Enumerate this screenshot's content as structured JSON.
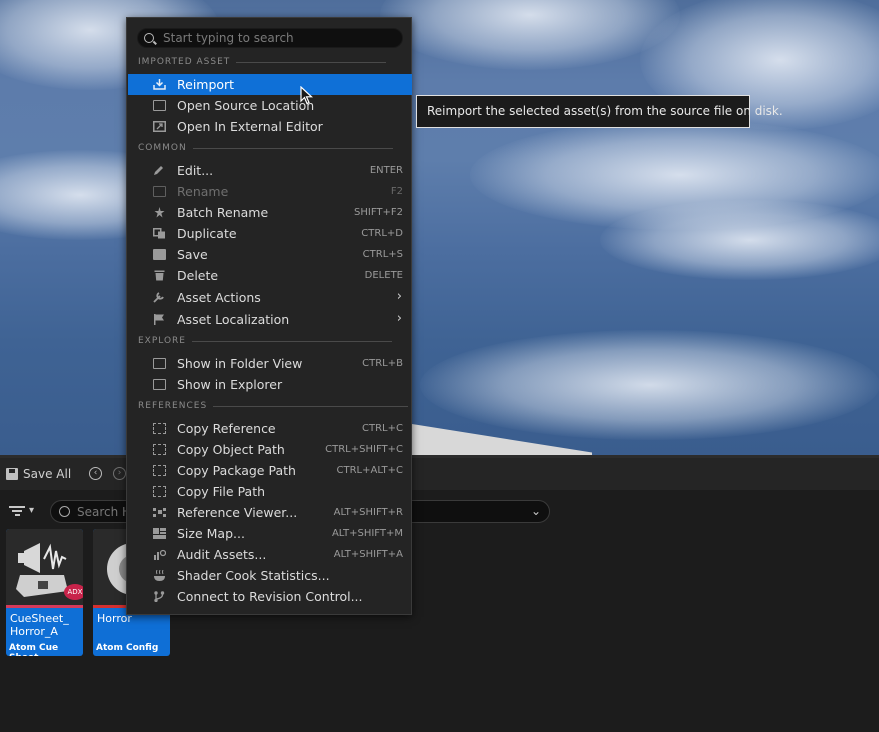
{
  "menu": {
    "search_placeholder": "Start typing to search",
    "sections": {
      "imported": "IMPORTED ASSET",
      "common": "COMMON",
      "explore": "EXPLORE",
      "references": "REFERENCES"
    },
    "imported_items": [
      {
        "label": "Reimport",
        "shortcut": "",
        "icon": "reimport-icon"
      },
      {
        "label": "Open Source Location",
        "shortcut": "",
        "icon": "open-source-location-icon"
      },
      {
        "label": "Open In External Editor",
        "shortcut": "",
        "icon": "external-editor-icon"
      }
    ],
    "common_items": [
      {
        "label": "Edit...",
        "shortcut": "ENTER",
        "icon": "pencil-icon"
      },
      {
        "label": "Rename",
        "shortcut": "F2",
        "icon": "rename-icon"
      },
      {
        "label": "Batch Rename",
        "shortcut": "SHIFT+F2",
        "icon": "batch-rename-icon"
      },
      {
        "label": "Duplicate",
        "shortcut": "CTRL+D",
        "icon": "duplicate-icon"
      },
      {
        "label": "Save",
        "shortcut": "CTRL+S",
        "icon": "save-icon"
      },
      {
        "label": "Delete",
        "shortcut": "DELETE",
        "icon": "trash-icon"
      },
      {
        "label": "Asset Actions",
        "shortcut": "",
        "icon": "wrench-icon"
      },
      {
        "label": "Asset Localization",
        "shortcut": "",
        "icon": "flag-icon"
      }
    ],
    "explore_items": [
      {
        "label": "Show in Folder View",
        "shortcut": "CTRL+B",
        "icon": "folder-search-icon"
      },
      {
        "label": "Show in Explorer",
        "shortcut": "",
        "icon": "explorer-icon"
      }
    ],
    "reference_items": [
      {
        "label": "Copy Reference",
        "shortcut": "CTRL+C",
        "icon": "copy-icon"
      },
      {
        "label": "Copy Object Path",
        "shortcut": "CTRL+SHIFT+C",
        "icon": "copy-icon"
      },
      {
        "label": "Copy Package Path",
        "shortcut": "CTRL+ALT+C",
        "icon": "copy-icon"
      },
      {
        "label": "Copy File Path",
        "shortcut": "",
        "icon": "copy-icon"
      },
      {
        "label": "Reference Viewer...",
        "shortcut": "ALT+SHIFT+R",
        "icon": "reference-viewer-icon"
      },
      {
        "label": "Size Map...",
        "shortcut": "ALT+SHIFT+M",
        "icon": "size-map-icon"
      },
      {
        "label": "Audit Assets...",
        "shortcut": "ALT+SHIFT+A",
        "icon": "audit-icon"
      },
      {
        "label": "Shader Cook Statistics...",
        "shortcut": "",
        "icon": "shader-cook-icon"
      },
      {
        "label": "Connect to Revision Control...",
        "shortcut": "",
        "icon": "revision-control-icon"
      }
    ]
  },
  "tooltip": "Reimport the selected asset(s) from the source file on disk.",
  "toolbar": {
    "save_all": "Save All"
  },
  "filter": {
    "search_placeholder": "Search H"
  },
  "assets": [
    {
      "name_line1": "CueSheet_",
      "name_line2": "Horror_A",
      "type": "Atom Cue Sheet",
      "badge": "ADX",
      "bar_color": "#d63a5a"
    },
    {
      "name_line1": "Horror",
      "name_line2": "",
      "type": "Atom Config",
      "bar_color": "#d43030"
    }
  ],
  "colors": {
    "highlight": "#0f70d7",
    "menu_bg": "#242424",
    "tile": "#0f6fd6"
  }
}
